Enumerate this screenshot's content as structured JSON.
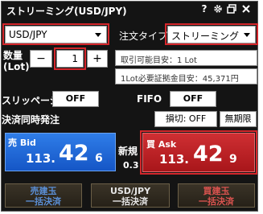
{
  "titlebar": {
    "title": "ストリーミング(USD/JPY)",
    "help_glyph": "?",
    "icons": [
      "help-icon",
      "gear-icon",
      "restore-icon",
      "close-icon"
    ]
  },
  "symbol": {
    "value": "USD/JPY"
  },
  "order_type": {
    "label": "注文タイプ",
    "value": "ストリーミング"
  },
  "quantity": {
    "label_line1": "数量",
    "label_line2": "(Lot)",
    "minus": "−",
    "value": "1",
    "plus": "+"
  },
  "info": {
    "tradable": "取引可能目安：1 Lot",
    "margin": "1Lot必要証拠金目安：45,371円"
  },
  "slippage": {
    "label": "スリッページ",
    "value": "OFF"
  },
  "fifo": {
    "label": "FIFO",
    "value": "OFF"
  },
  "settlement": {
    "label": "決済同時発注",
    "stoploss": "損切: OFF",
    "expiry": "無期限"
  },
  "bid": {
    "side_kanji": "売",
    "side_en": "Bid",
    "price_small": "113.",
    "price_big": "42",
    "price_last": "6"
  },
  "spread": {
    "label": "新規",
    "value": "0.3"
  },
  "ask": {
    "side_kanji": "買",
    "side_en": "Ask",
    "price_small": "113.",
    "price_big": "42",
    "price_last": "9"
  },
  "bulk": {
    "sell_line1": "売建玉",
    "sell_line2": "一括決済",
    "pair_line1": "USD/JPY",
    "pair_line2": "一括決済",
    "buy_line1": "買建玉",
    "buy_line2": "一括決済"
  },
  "colors": {
    "accent_red": "#d4262b",
    "bid_blue": "#1f64d8",
    "ask_red": "#b81d21",
    "sell_text": "#5b8fd6",
    "buy_text": "#d9534f",
    "neutral_text": "#e6e6e6"
  }
}
